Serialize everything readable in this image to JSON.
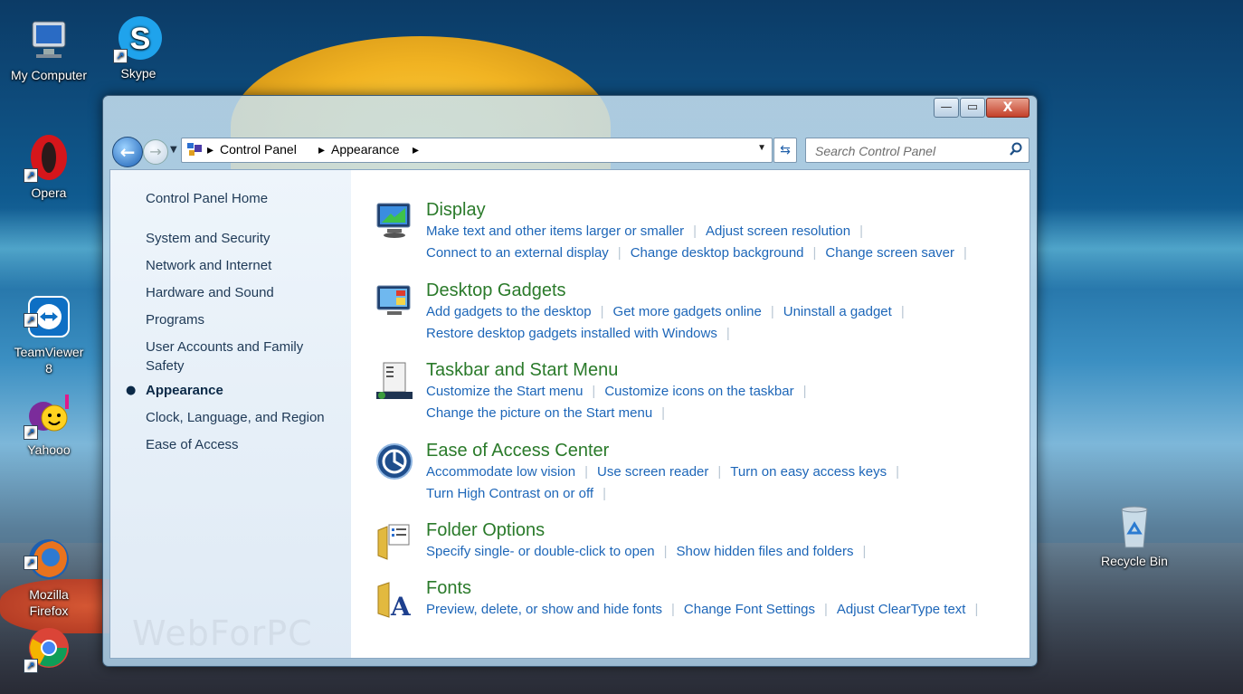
{
  "desktop": {
    "icons": [
      {
        "label": "My Computer"
      },
      {
        "label": "Skype"
      },
      {
        "label": "Opera"
      },
      {
        "label": "TeamViewer\n8"
      },
      {
        "label": "Yahooo"
      },
      {
        "label": "Mozilla\nFirefox"
      },
      {
        "label": "Recycle Bin"
      }
    ]
  },
  "window": {
    "caption": {
      "minimize": "—",
      "maximize": "▭",
      "close": "X"
    },
    "breadcrumb": [
      "Control Panel",
      "Appearance"
    ],
    "search": {
      "placeholder": "Search Control Panel"
    },
    "left_nav": {
      "home": "Control Panel Home",
      "items": [
        "System and Security",
        "Network and Internet",
        "Hardware and Sound",
        "Programs",
        "User Accounts and Family Safety",
        "Appearance",
        "Clock, Language, and Region",
        "Ease of Access"
      ],
      "current": "Appearance"
    },
    "watermark": "WebForPC",
    "categories": [
      {
        "title": "Display",
        "icon": "display-icon",
        "lines": [
          [
            "Make text and other items larger or smaller",
            "Adjust screen resolution"
          ],
          [
            "Connect to an external display",
            "Change desktop background",
            "Change screen saver"
          ]
        ]
      },
      {
        "title": "Desktop Gadgets",
        "icon": "gadgets-icon",
        "lines": [
          [
            "Add gadgets to the desktop",
            "Get more gadgets online",
            "Uninstall a gadget"
          ],
          [
            "Restore desktop gadgets installed with Windows"
          ]
        ]
      },
      {
        "title": "Taskbar and Start Menu",
        "icon": "taskbar-icon",
        "lines": [
          [
            "Customize the Start menu",
            "Customize icons on the taskbar"
          ],
          [
            "Change the picture on the Start menu"
          ]
        ]
      },
      {
        "title": "Ease of Access Center",
        "icon": "ease-of-access-icon",
        "lines": [
          [
            "Accommodate low vision",
            "Use screen reader",
            "Turn on easy access keys"
          ],
          [
            "Turn High Contrast on or off"
          ]
        ]
      },
      {
        "title": "Folder Options",
        "icon": "folder-options-icon",
        "lines": [
          [
            "Specify single- or double-click to open",
            "Show hidden files and folders"
          ]
        ]
      },
      {
        "title": "Fonts",
        "icon": "fonts-icon",
        "lines": [
          [
            "Preview, delete, or show and hide fonts",
            "Change Font Settings",
            "Adjust ClearType text"
          ]
        ]
      }
    ]
  }
}
